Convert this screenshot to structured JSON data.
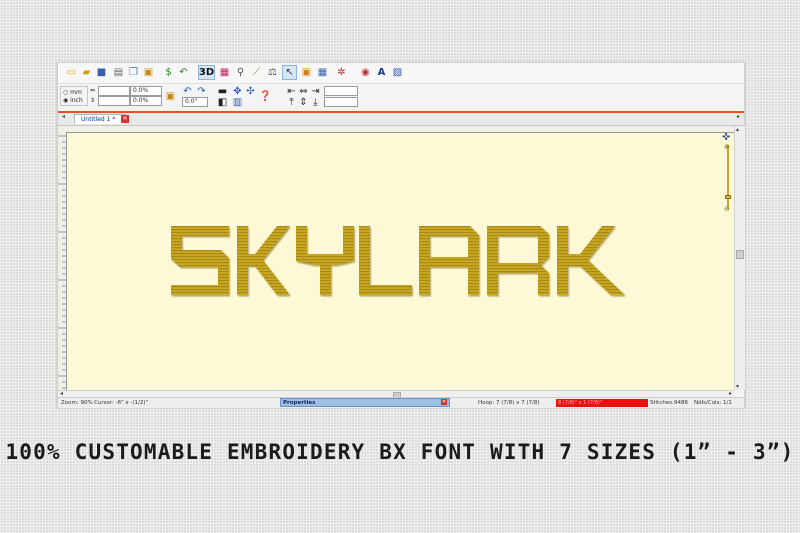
{
  "toolbar": {
    "icons": [
      "new-icon",
      "open-icon",
      "save-icon",
      "print-icon",
      "copy-icon",
      "paste-icon",
      "dollar-icon",
      "reverse-icon",
      "3d-view-icon",
      "color-icon",
      "zoom-icon",
      "ruler-icon",
      "scale-icon",
      "select-icon",
      "hoop-icon",
      "grid-icon",
      "stitch-icon",
      "text-icon",
      "export-icon"
    ],
    "view_3d_label": "3D"
  },
  "units": {
    "mm_label": "mm",
    "inch_label": "inch",
    "selected": "inch"
  },
  "transform": {
    "width_value": "0.0%",
    "height_value": "0.0%",
    "angle_value": "0.0°"
  },
  "tabs": [
    {
      "label": "Untitled 1 *"
    }
  ],
  "design": {
    "text": "SKYLARK",
    "thread_color": "#c9a820"
  },
  "status": {
    "zoom": "Zoom: 90%",
    "cursor": "Cursor: -6\" x -(1/2)\"",
    "properties_label": "Properties",
    "hoop": "Hoop: 7 (7/8) x 7 (7/8)",
    "size": "8 (7/8)\" x 1 (7/8)\"",
    "stitches": "Stitches:9486",
    "needles": "Ndls/Cols: 1/1"
  },
  "caption": "100% CUSTOMABLE EMBROIDERY BX FONT WITH 7 SIZES (1” -  3”)"
}
